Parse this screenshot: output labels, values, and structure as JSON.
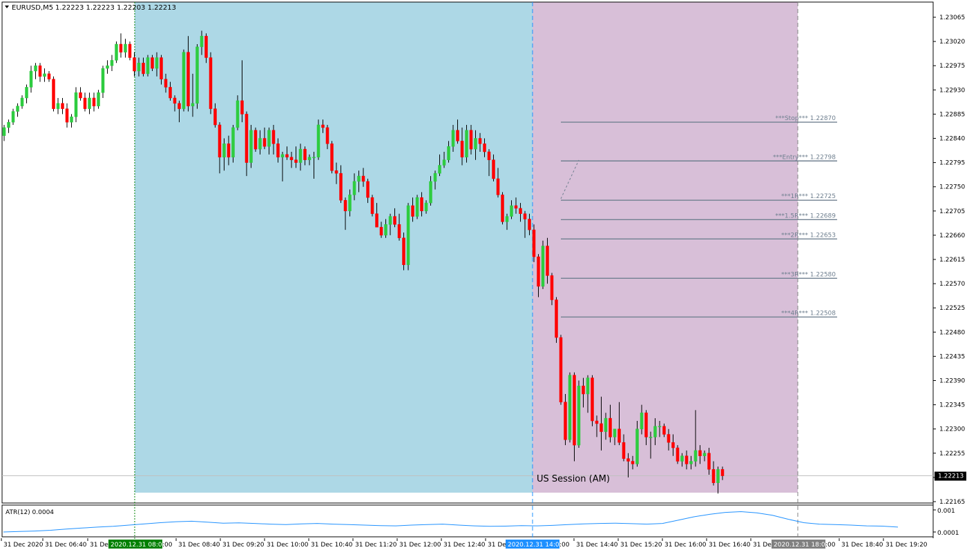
{
  "symbol_label": "EURUSD,M5",
  "ohlc_label": "1.22223 1.22223 1.22203 1.22213",
  "session_label": "US Session (AM)",
  "indicator": {
    "name_label": "ATR(12) 0.0004",
    "scale_top": "0.001",
    "scale_bottom": "0.0001"
  },
  "colors": {
    "bull": "#2ecc40",
    "bull_dark": "#0a5c1e",
    "bear": "#ff0000",
    "session_asia": "#add8e6",
    "session_us": "#d8bfd8",
    "level_line": "#708090",
    "atr_line": "#1e90ff"
  },
  "price_axis": {
    "ticks": [
      "1.23065",
      "1.23020",
      "1.22975",
      "1.22930",
      "1.22885",
      "1.22840",
      "1.22795",
      "1.22750",
      "1.22705",
      "1.22660",
      "1.22615",
      "1.22570",
      "1.22525",
      "1.22480",
      "1.22435",
      "1.22390",
      "1.22345",
      "1.22300",
      "1.22255",
      "1.22210",
      "1.22165"
    ],
    "current_price": "1.22213"
  },
  "time_axis": {
    "labels": [
      "31 Dec 2020",
      "31 Dec 06:40",
      "31 De",
      "31 Dec 08:40",
      "31 Dec 09:20",
      "31 Dec 10:00",
      "31 Dec 10:40",
      "31 Dec 11:20",
      "31 Dec 12:00",
      "31 Dec 12:40",
      "31 De",
      "31 Dec 14:40",
      "31 Dec 15:20",
      "31 Dec 16:00",
      "31 Dec 16:40",
      "31 De",
      "31 Dec 18:40",
      "31 Dec 19:20"
    ],
    "markers": [
      "2020.12.31 08:00",
      "2020.12.31 14:00",
      "2020.12.31 18:00"
    ],
    "marker_tails": [
      ":00",
      ":00",
      ":00"
    ]
  },
  "trade_levels": [
    {
      "label": "***Stop*** 1.22870",
      "price": 1.2287
    },
    {
      "label": "***Entry*** 1.22798",
      "price": 1.22798
    },
    {
      "label": "***1R*** 1.22725",
      "price": 1.22725
    },
    {
      "label": "***1.5R*** 1.22689",
      "price": 1.22689
    },
    {
      "label": "***2R*** 1.22653",
      "price": 1.22653
    },
    {
      "label": "***3R*** 1.22580",
      "price": 1.2258
    },
    {
      "label": "***4R*** 1.22508",
      "price": 1.22508
    }
  ],
  "chart_data": {
    "type": "candlestick",
    "symbol": "EURUSD",
    "timeframe": "M5",
    "ylim": [
      1.2214,
      1.23085
    ],
    "candles": [
      [
        1.22845,
        1.22865,
        1.22835,
        1.2286
      ],
      [
        1.2286,
        1.22875,
        1.2285,
        1.2287
      ],
      [
        1.2287,
        1.22895,
        1.22865,
        1.2289
      ],
      [
        1.2289,
        1.22905,
        1.2288,
        1.229
      ],
      [
        1.229,
        1.2292,
        1.22895,
        1.22915
      ],
      [
        1.22915,
        1.2294,
        1.22905,
        1.22935
      ],
      [
        1.22935,
        1.22975,
        1.22925,
        1.22965
      ],
      [
        1.22965,
        1.2298,
        1.2295,
        1.22975
      ],
      [
        1.22975,
        1.2298,
        1.22945,
        1.22955
      ],
      [
        1.22955,
        1.2297,
        1.22945,
        1.2296
      ],
      [
        1.2296,
        1.22965,
        1.22945,
        1.2295
      ],
      [
        1.2295,
        1.22955,
        1.2289,
        1.22895
      ],
      [
        1.22895,
        1.22915,
        1.22885,
        1.22905
      ],
      [
        1.22905,
        1.22915,
        1.22885,
        1.22895
      ],
      [
        1.22895,
        1.22905,
        1.2286,
        1.2287
      ],
      [
        1.2287,
        1.22885,
        1.2286,
        1.2288
      ],
      [
        1.2288,
        1.22935,
        1.2287,
        1.22925
      ],
      [
        1.22925,
        1.22935,
        1.2291,
        1.22915
      ],
      [
        1.22915,
        1.22925,
        1.2289,
        1.22895
      ],
      [
        1.22895,
        1.22925,
        1.22885,
        1.22915
      ],
      [
        1.22915,
        1.22925,
        1.2289,
        1.229
      ],
      [
        1.229,
        1.2293,
        1.22895,
        1.22925
      ],
      [
        1.22925,
        1.22975,
        1.22915,
        1.2297
      ],
      [
        1.2297,
        1.22985,
        1.2296,
        1.22975
      ],
      [
        1.22975,
        1.22995,
        1.22965,
        1.22985
      ],
      [
        1.22985,
        1.2302,
        1.2298,
        1.23015
      ],
      [
        1.23015,
        1.23035,
        1.2299,
        1.23
      ],
      [
        1.23,
        1.23025,
        1.2299,
        1.23015
      ],
      [
        1.23015,
        1.2302,
        1.22985,
        1.2299
      ],
      [
        1.2299,
        1.23,
        1.22955,
        1.22965
      ],
      [
        1.22965,
        1.2299,
        1.22955,
        1.2298
      ],
      [
        1.2298,
        1.2299,
        1.22955,
        1.2296
      ],
      [
        1.2296,
        1.22995,
        1.22955,
        1.2299
      ],
      [
        1.2299,
        1.22995,
        1.22965,
        1.2297
      ],
      [
        1.2297,
        1.23,
        1.22955,
        1.2299
      ],
      [
        1.2299,
        1.22995,
        1.2294,
        1.2295
      ],
      [
        1.2295,
        1.2296,
        1.22925,
        1.22935
      ],
      [
        1.22935,
        1.22945,
        1.2291,
        1.22915
      ],
      [
        1.22915,
        1.2292,
        1.2289,
        1.22905
      ],
      [
        1.22905,
        1.2291,
        1.2287,
        1.22895
      ],
      [
        1.22895,
        1.23005,
        1.2289,
        1.23
      ],
      [
        1.23,
        1.2303,
        1.2289,
        1.229
      ],
      [
        1.229,
        1.2296,
        1.2288,
        1.22905
      ],
      [
        1.22905,
        1.23015,
        1.22895,
        1.2301
      ],
      [
        1.2301,
        1.2304,
        1.22995,
        1.2303
      ],
      [
        1.2303,
        1.23035,
        1.2298,
        1.2299
      ],
      [
        1.2299,
        1.23,
        1.22885,
        1.22895
      ],
      [
        1.22895,
        1.22905,
        1.2286,
        1.22865
      ],
      [
        1.22865,
        1.2287,
        1.22775,
        1.22805
      ],
      [
        1.22805,
        1.2284,
        1.2278,
        1.2283
      ],
      [
        1.2283,
        1.22845,
        1.2279,
        1.22805
      ],
      [
        1.22805,
        1.22865,
        1.22795,
        1.2286
      ],
      [
        1.2286,
        1.2292,
        1.22855,
        1.2291
      ],
      [
        1.2291,
        1.22985,
        1.2287,
        1.22885
      ],
      [
        1.22885,
        1.2289,
        1.2277,
        1.22795
      ],
      [
        1.22795,
        1.22865,
        1.22785,
        1.22855
      ],
      [
        1.22855,
        1.2286,
        1.22815,
        1.2282
      ],
      [
        1.2282,
        1.22855,
        1.2281,
        1.2284
      ],
      [
        1.2284,
        1.2286,
        1.2282,
        1.22825
      ],
      [
        1.22825,
        1.2286,
        1.2281,
        1.22855
      ],
      [
        1.22855,
        1.22865,
        1.2281,
        1.2283
      ],
      [
        1.2283,
        1.2284,
        1.22795,
        1.22805
      ],
      [
        1.22805,
        1.22815,
        1.2276,
        1.2281
      ],
      [
        1.2281,
        1.22825,
        1.228,
        1.22805
      ],
      [
        1.22805,
        1.22815,
        1.22785,
        1.228
      ],
      [
        1.228,
        1.22825,
        1.22785,
        1.22795
      ],
      [
        1.22795,
        1.2283,
        1.2278,
        1.2282
      ],
      [
        1.2282,
        1.22825,
        1.2279,
        1.228
      ],
      [
        1.228,
        1.2281,
        1.2279,
        1.22805
      ],
      [
        1.22805,
        1.22815,
        1.22765,
        1.22805
      ],
      [
        1.22805,
        1.22875,
        1.228,
        1.22865
      ],
      [
        1.22865,
        1.22875,
        1.2285,
        1.2286
      ],
      [
        1.2286,
        1.22865,
        1.2282,
        1.2283
      ],
      [
        1.2283,
        1.22835,
        1.22775,
        1.2278
      ],
      [
        1.2278,
        1.22795,
        1.22755,
        1.22775
      ],
      [
        1.22775,
        1.2279,
        1.2272,
        1.22725
      ],
      [
        1.22725,
        1.2273,
        1.2267,
        1.22705
      ],
      [
        1.22705,
        1.22745,
        1.22695,
        1.22735
      ],
      [
        1.22735,
        1.22775,
        1.22725,
        1.2276
      ],
      [
        1.2276,
        1.2278,
        1.2274,
        1.2277
      ],
      [
        1.2277,
        1.22785,
        1.2275,
        1.2276
      ],
      [
        1.2276,
        1.22765,
        1.2272,
        1.2273
      ],
      [
        1.2273,
        1.22735,
        1.22695,
        1.227
      ],
      [
        1.227,
        1.2272,
        1.22675,
        1.22675
      ],
      [
        1.22675,
        1.22685,
        1.22655,
        1.2266
      ],
      [
        1.2266,
        1.2269,
        1.22655,
        1.2268
      ],
      [
        1.2268,
        1.227,
        1.2266,
        1.22695
      ],
      [
        1.22695,
        1.2271,
        1.22675,
        1.2268
      ],
      [
        1.2268,
        1.227,
        1.2265,
        1.22655
      ],
      [
        1.22655,
        1.22665,
        1.22595,
        1.22605
      ],
      [
        1.22605,
        1.2272,
        1.22595,
        1.22715
      ],
      [
        1.22715,
        1.2273,
        1.22685,
        1.22695
      ],
      [
        1.22695,
        1.22735,
        1.2269,
        1.2273
      ],
      [
        1.2273,
        1.2274,
        1.22695,
        1.22705
      ],
      [
        1.22705,
        1.22725,
        1.227,
        1.2272
      ],
      [
        1.2272,
        1.2277,
        1.22715,
        1.2276
      ],
      [
        1.2276,
        1.2278,
        1.22745,
        1.22775
      ],
      [
        1.22775,
        1.2281,
        1.2277,
        1.2279
      ],
      [
        1.2279,
        1.22815,
        1.22785,
        1.228
      ],
      [
        1.228,
        1.22835,
        1.22795,
        1.22825
      ],
      [
        1.22825,
        1.22865,
        1.22815,
        1.22855
      ],
      [
        1.22855,
        1.22875,
        1.2283,
        1.22835
      ],
      [
        1.22835,
        1.2286,
        1.2279,
        1.22805
      ],
      [
        1.22805,
        1.22865,
        1.22795,
        1.22855
      ],
      [
        1.22855,
        1.22865,
        1.2281,
        1.2282
      ],
      [
        1.2282,
        1.22855,
        1.228,
        1.2284
      ],
      [
        1.2284,
        1.2285,
        1.22815,
        1.2283
      ],
      [
        1.2283,
        1.2284,
        1.22805,
        1.22815
      ],
      [
        1.22815,
        1.2282,
        1.2277,
        1.228
      ],
      [
        1.228,
        1.2281,
        1.2276,
        1.22765
      ],
      [
        1.22765,
        1.22785,
        1.2273,
        1.22735
      ],
      [
        1.22735,
        1.2274,
        1.2268,
        1.22685
      ],
      [
        1.22685,
        1.227,
        1.2267,
        1.22695
      ],
      [
        1.22695,
        1.22725,
        1.2269,
        1.22715
      ],
      [
        1.22715,
        1.2273,
        1.227,
        1.2271
      ],
      [
        1.2271,
        1.2272,
        1.22685,
        1.227
      ],
      [
        1.227,
        1.22705,
        1.22655,
        1.2269
      ],
      [
        1.2269,
        1.227,
        1.2266,
        1.2267
      ],
      [
        1.2267,
        1.2268,
        1.2261,
        1.2262
      ],
      [
        1.2262,
        1.22625,
        1.22545,
        1.22565
      ],
      [
        1.22565,
        1.2265,
        1.2256,
        1.2264
      ],
      [
        1.2264,
        1.22655,
        1.2257,
        1.22585
      ],
      [
        1.22585,
        1.2259,
        1.2253,
        1.2254
      ],
      [
        1.2254,
        1.22545,
        1.2246,
        1.2247
      ],
      [
        1.2247,
        1.22475,
        1.22345,
        1.2235
      ],
      [
        1.2235,
        1.22365,
        1.2227,
        1.2228
      ],
      [
        1.2228,
        1.22405,
        1.22275,
        1.224
      ],
      [
        1.224,
        1.22405,
        1.2224,
        1.2227
      ],
      [
        1.2227,
        1.2239,
        1.22265,
        1.2238
      ],
      [
        1.2238,
        1.22395,
        1.2234,
        1.22365
      ],
      [
        1.22365,
        1.224,
        1.2233,
        1.22395
      ],
      [
        1.22395,
        1.224,
        1.22305,
        1.22315
      ],
      [
        1.22315,
        1.22325,
        1.22285,
        1.2231
      ],
      [
        1.2231,
        1.2236,
        1.2226,
        1.22295
      ],
      [
        1.22295,
        1.2233,
        1.2228,
        1.2232
      ],
      [
        1.2232,
        1.22345,
        1.22275,
        1.22285
      ],
      [
        1.22285,
        1.223,
        1.2227,
        1.223
      ],
      [
        1.223,
        1.2235,
        1.2227,
        1.22275
      ],
      [
        1.22275,
        1.2229,
        1.2224,
        1.22245
      ],
      [
        1.22245,
        1.22255,
        1.2221,
        1.2224
      ],
      [
        1.2224,
        1.2225,
        1.22225,
        1.22235
      ],
      [
        1.22235,
        1.22315,
        1.2223,
        1.223
      ],
      [
        1.223,
        1.22345,
        1.2229,
        1.2233
      ],
      [
        1.2233,
        1.22335,
        1.2227,
        1.22285
      ],
      [
        1.22285,
        1.22295,
        1.22245,
        1.22285
      ],
      [
        1.22285,
        1.2232,
        1.2227,
        1.22305
      ],
      [
        1.22305,
        1.22315,
        1.22285,
        1.22305
      ],
      [
        1.22305,
        1.2231,
        1.22285,
        1.2229
      ],
      [
        1.2229,
        1.223,
        1.2226,
        1.22275
      ],
      [
        1.22275,
        1.2229,
        1.2225,
        1.22265
      ],
      [
        1.22265,
        1.2227,
        1.22235,
        1.2224
      ],
      [
        1.2224,
        1.22255,
        1.2223,
        1.2225
      ],
      [
        1.2225,
        1.2226,
        1.22225,
        1.22235
      ],
      [
        1.22235,
        1.2225,
        1.22225,
        1.2224
      ],
      [
        1.2224,
        1.22335,
        1.2223,
        1.2226
      ],
      [
        1.2226,
        1.2227,
        1.22235,
        1.2225
      ],
      [
        1.2225,
        1.2226,
        1.2224,
        1.22255
      ],
      [
        1.22255,
        1.22265,
        1.22215,
        1.22225
      ],
      [
        1.22225,
        1.2224,
        1.22195,
        1.222
      ],
      [
        1.222,
        1.2223,
        1.2218,
        1.22225
      ],
      [
        1.22225,
        1.2223,
        1.22205,
        1.22213
      ]
    ],
    "atr": [
      0.0001,
      0.00012,
      0.00014,
      0.00017,
      0.00022,
      0.00026,
      0.0003,
      0.00033,
      0.00038,
      0.00043,
      0.00048,
      0.00052,
      0.00054,
      0.0005,
      0.00046,
      0.00047,
      0.00045,
      0.00042,
      0.0004,
      0.00043,
      0.00045,
      0.00042,
      0.0004,
      0.00038,
      0.00036,
      0.00035,
      0.00038,
      0.0004,
      0.00042,
      0.00038,
      0.00035,
      0.00033,
      0.00034,
      0.00036,
      0.00035,
      0.00037,
      0.0004,
      0.00043,
      0.00045,
      0.00046,
      0.00044,
      0.00042,
      0.00045,
      0.00058,
      0.00072,
      0.00082,
      0.0009,
      0.00093,
      0.00088,
      0.00078,
      0.00062,
      0.00048,
      0.00042,
      0.0004,
      0.00038,
      0.00035,
      0.00034,
      0.0003
    ],
    "levels": [
      1.2287,
      1.22798,
      1.22725,
      1.22689,
      1.22653,
      1.2258,
      1.22508
    ],
    "sessions": [
      {
        "name": "",
        "start": "2020.12.31 08:00",
        "end": "2020.12.31 14:00"
      },
      {
        "name": "US Session (AM)",
        "start": "2020.12.31 14:00",
        "end": "2020.12.31 18:00"
      }
    ]
  }
}
